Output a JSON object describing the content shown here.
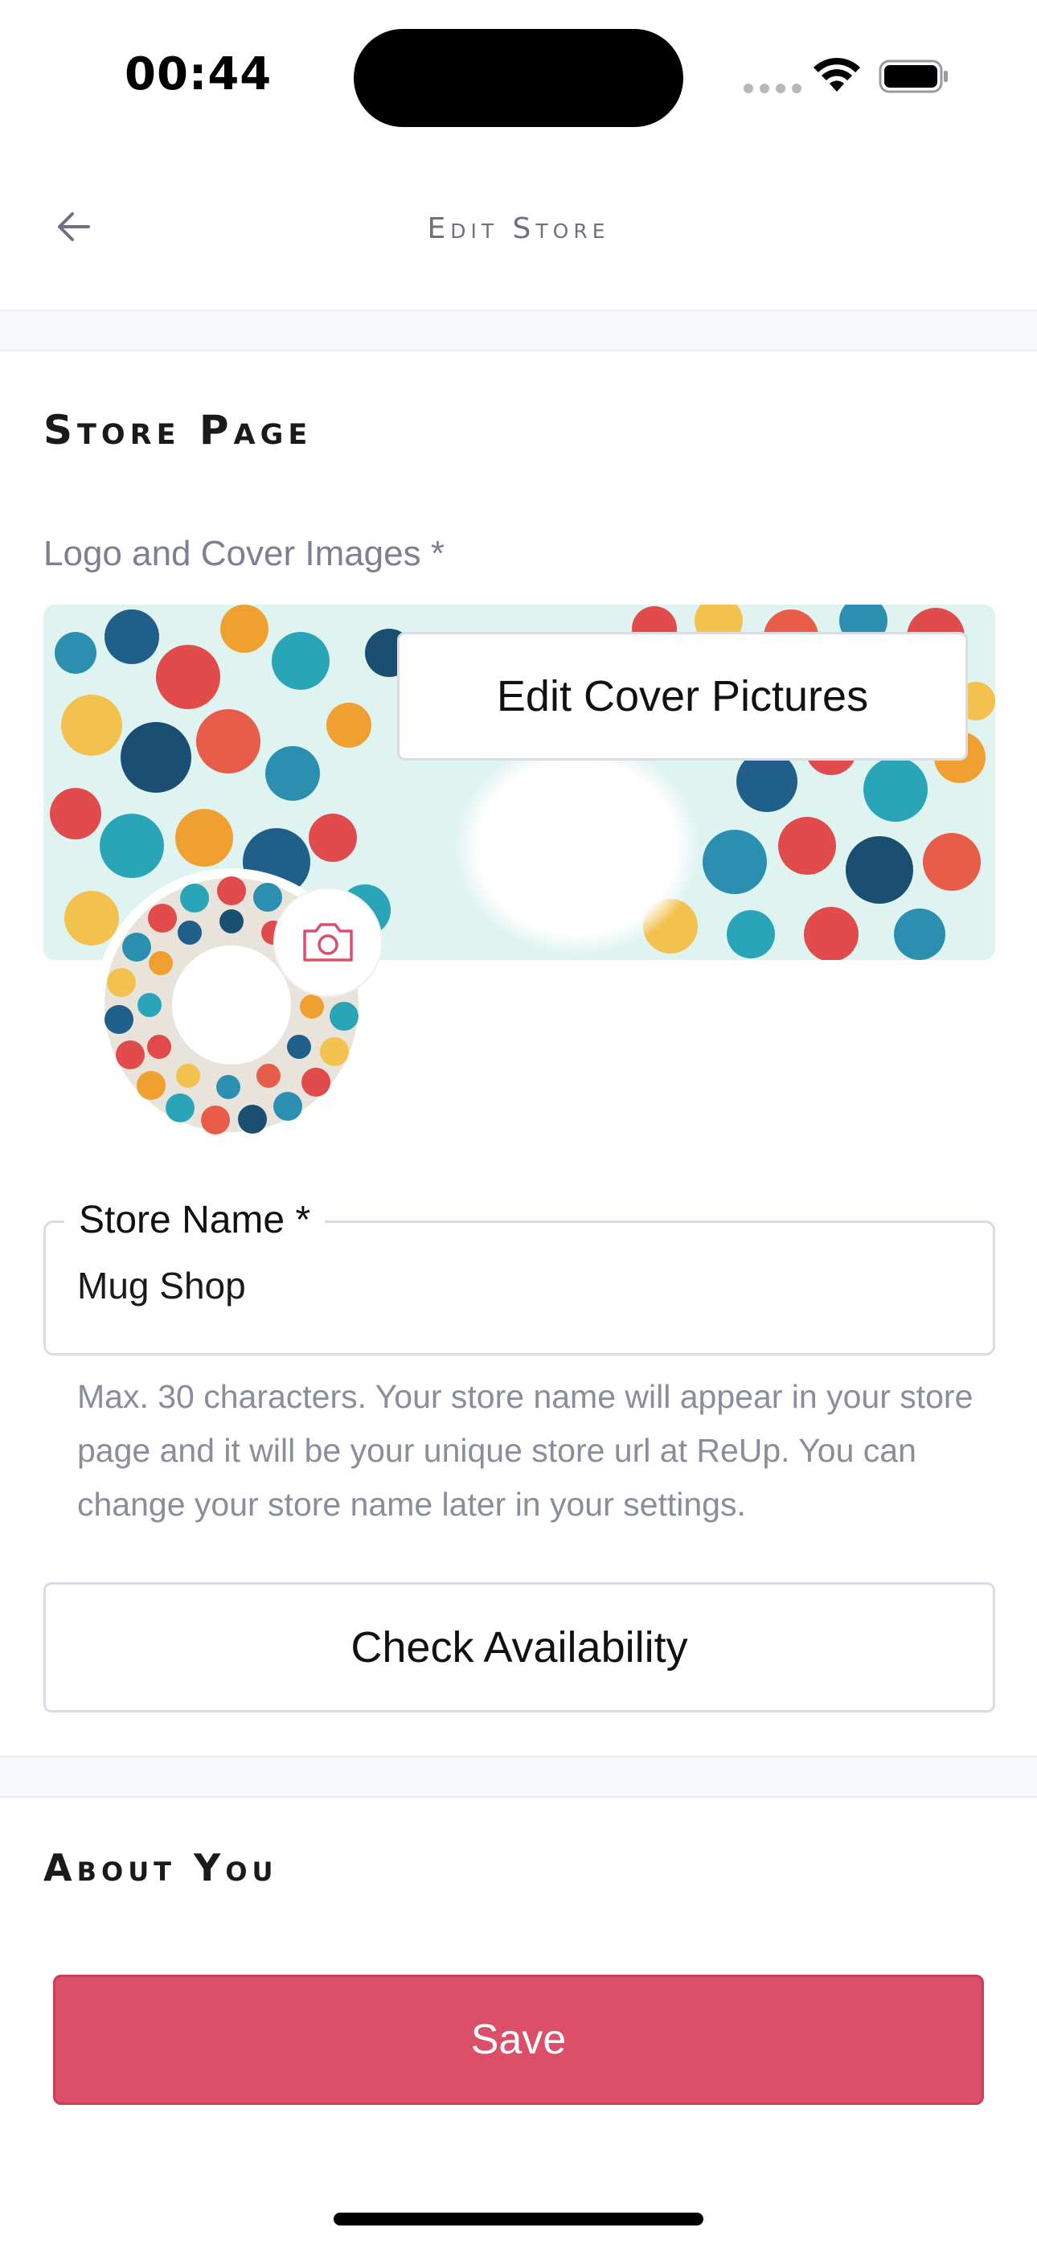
{
  "status_bar": {
    "time": "00:44",
    "icons": [
      "signal-icon",
      "wifi-icon",
      "battery-icon"
    ]
  },
  "header": {
    "title": "Edit Store",
    "back_icon": "arrow-left-icon"
  },
  "store_page": {
    "section_title": "Store Page",
    "images_label": "Logo and Cover Images *",
    "edit_cover_label": "Edit Cover Pictures",
    "camera_icon": "camera-icon"
  },
  "store_name": {
    "label": "Store Name *",
    "value": "Mug Shop",
    "helper": "Max. 30 characters. Your store name will appear in your store page and it will be your unique store url at ReUp. You can change your store name later in your settings."
  },
  "check_availability_label": "Check Availability",
  "about_you": {
    "section_title": "About You"
  },
  "save_label": "Save",
  "colors": {
    "accent": "#dc4f69",
    "muted_text": "#7c8092",
    "border": "#d9dce6",
    "divider_bg": "#f7f8fc"
  }
}
